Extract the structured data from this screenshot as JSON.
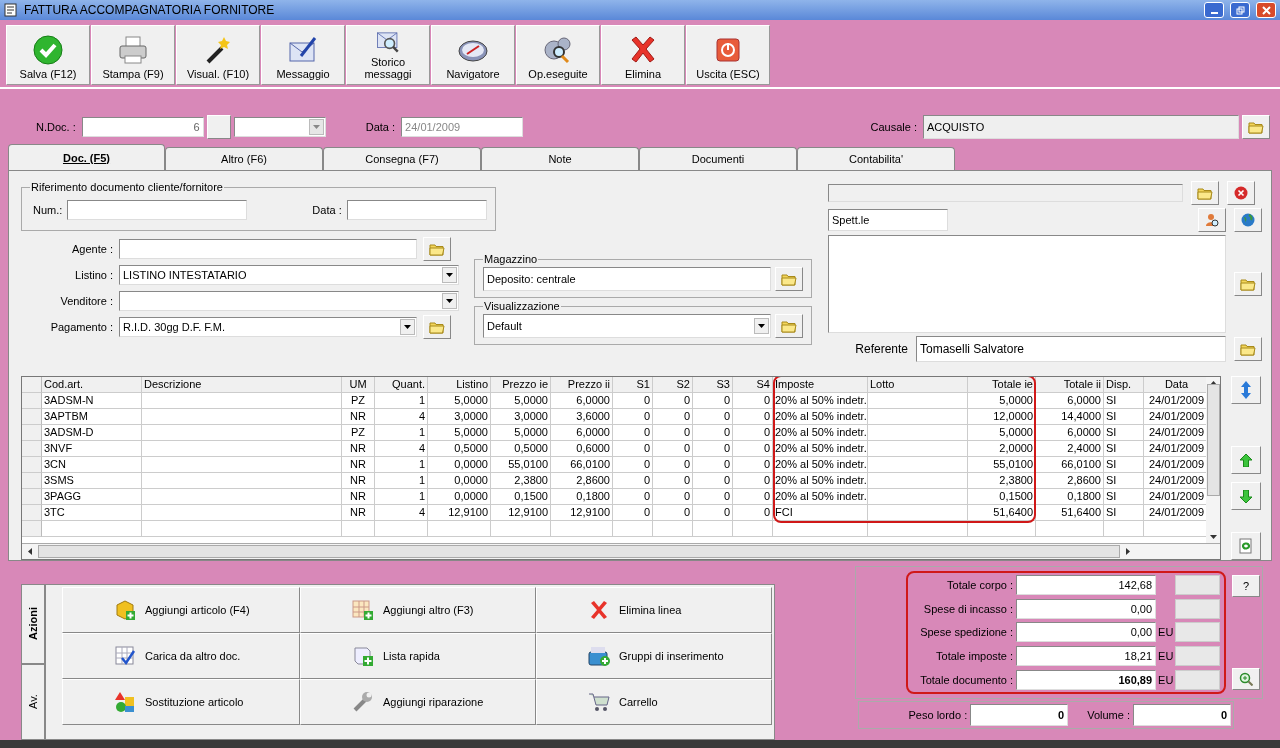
{
  "window": {
    "title": "FATTURA ACCOMPAGNATORIA FORNITORE"
  },
  "toolbar": [
    "Salva (F12)",
    "Stampa (F9)",
    "Visual. (F10)",
    "Messaggio",
    "Storico messaggi",
    "Navigatore",
    "Op.eseguite",
    "Elimina",
    "Uscita (ESC)"
  ],
  "header": {
    "ndoc_label": "N.Doc. :",
    "ndoc": "6",
    "data_label": "Data :",
    "data": "24/01/2009",
    "causale_label": "Causale :",
    "causale": "ACQUISTO"
  },
  "tabs": [
    {
      "label": "Doc. (F5)",
      "selected": true
    },
    {
      "label": "Altro (F6)",
      "selected": false
    },
    {
      "label": "Consegna (F7)",
      "selected": false
    },
    {
      "label": "Note",
      "selected": false
    },
    {
      "label": "Documenti",
      "selected": false
    },
    {
      "label": "Contabilita'",
      "selected": false
    }
  ],
  "riferimento": {
    "legend": "Riferimento documento cliente/fornitore",
    "num_label": "Num.:",
    "data_label": "Data :"
  },
  "fields": [
    {
      "label": "Agente :",
      "kind": "text",
      "folder": true
    },
    {
      "label": "Listino :",
      "value": "LISTINO INTESTATARIO",
      "kind": "combo",
      "folder": false
    },
    {
      "label": "Venditore :",
      "kind": "combo",
      "folder": false
    },
    {
      "label": "Pagamento :",
      "value": "R.I.D. 30gg D.F. F.M.",
      "kind": "combo",
      "folder": true
    }
  ],
  "magazzino": {
    "legend": "Magazzino",
    "value": "Deposito: centrale"
  },
  "visualizzazione": {
    "legend": "Visualizzazione",
    "value": "Default"
  },
  "intestatario": {
    "title": "Spett.le",
    "referente_label": "Referente",
    "referente": "Tomaselli Salvatore"
  },
  "table": {
    "columns": [
      "Cod.art.",
      "Descrizione",
      "UM",
      "Quant.",
      "Listino",
      "Prezzo ie",
      "Prezzo ii",
      "S1",
      "S2",
      "S3",
      "S4",
      "Imposte",
      "Lotto",
      "Totale ie",
      "Totale ii",
      "Disp.",
      "Data"
    ],
    "rows": [
      {
        "cod": "3ADSM-N",
        "um": "PZ",
        "quant": "1",
        "listino": "5,0000",
        "prezzo_ie": "5,0000",
        "prezzo_ii": "6,0000",
        "s1": "0",
        "s2": "0",
        "s3": "0",
        "s4": "0",
        "imposte": "20% al 50% indetr.",
        "totale_ie": "5,0000",
        "totale_ii": "6,0000",
        "disp": "SI",
        "data": "24/01/2009"
      },
      {
        "cod": "3APTBM",
        "um": "NR",
        "quant": "4",
        "listino": "3,0000",
        "prezzo_ie": "3,0000",
        "prezzo_ii": "3,6000",
        "s1": "0",
        "s2": "0",
        "s3": "0",
        "s4": "0",
        "imposte": "20% al 50% indetr.",
        "totale_ie": "12,0000",
        "totale_ii": "14,4000",
        "disp": "SI",
        "data": "24/01/2009"
      },
      {
        "cod": "3ADSM-D",
        "um": "PZ",
        "quant": "1",
        "listino": "5,0000",
        "prezzo_ie": "5,0000",
        "prezzo_ii": "6,0000",
        "s1": "0",
        "s2": "0",
        "s3": "0",
        "s4": "0",
        "imposte": "20% al 50% indetr.",
        "totale_ie": "5,0000",
        "totale_ii": "6,0000",
        "disp": "SI",
        "data": "24/01/2009"
      },
      {
        "cod": "3NVF",
        "um": "NR",
        "quant": "4",
        "listino": "0,5000",
        "prezzo_ie": "0,5000",
        "prezzo_ii": "0,6000",
        "s1": "0",
        "s2": "0",
        "s3": "0",
        "s4": "0",
        "imposte": "20% al 50% indetr.",
        "totale_ie": "2,0000",
        "totale_ii": "2,4000",
        "disp": "SI",
        "data": "24/01/2009"
      },
      {
        "cod": "3CN",
        "um": "NR",
        "quant": "1",
        "listino": "0,0000",
        "prezzo_ie": "55,0100",
        "prezzo_ii": "66,0100",
        "s1": "0",
        "s2": "0",
        "s3": "0",
        "s4": "0",
        "imposte": "20% al 50% indetr.",
        "totale_ie": "55,0100",
        "totale_ii": "66,0100",
        "disp": "SI",
        "data": "24/01/2009"
      },
      {
        "cod": "3SMS",
        "um": "NR",
        "quant": "1",
        "listino": "0,0000",
        "prezzo_ie": "2,3800",
        "prezzo_ii": "2,8600",
        "s1": "0",
        "s2": "0",
        "s3": "0",
        "s4": "0",
        "imposte": "20% al 50% indetr.",
        "totale_ie": "2,3800",
        "totale_ii": "2,8600",
        "disp": "SI",
        "data": "24/01/2009"
      },
      {
        "cod": "3PAGG",
        "um": "NR",
        "quant": "1",
        "listino": "0,0000",
        "prezzo_ie": "0,1500",
        "prezzo_ii": "0,1800",
        "s1": "0",
        "s2": "0",
        "s3": "0",
        "s4": "0",
        "imposte": "20% al 50% indetr.",
        "totale_ie": "0,1500",
        "totale_ii": "0,1800",
        "disp": "SI",
        "data": "24/01/2009"
      },
      {
        "cod": "3TC",
        "um": "NR",
        "quant": "4",
        "listino": "12,9100",
        "prezzo_ie": "12,9100",
        "prezzo_ii": "12,9100",
        "s1": "0",
        "s2": "0",
        "s3": "0",
        "s4": "0",
        "imposte": "FCI",
        "totale_ie": "51,6400",
        "totale_ii": "51,6400",
        "disp": "SI",
        "data": "24/01/2009"
      }
    ]
  },
  "side_tabs": [
    {
      "label": "Azioni",
      "selected": true
    },
    {
      "label": "Av.",
      "selected": false
    }
  ],
  "actions": [
    "Aggiungi articolo (F4)",
    "Aggiungi altro (F3)",
    "Elimina linea",
    "Carica da altro doc.",
    "Lista rapida",
    "Gruppi di inserimento",
    "Sostituzione articolo",
    "Aggiungi riparazione",
    "Carrello"
  ],
  "totals": [
    {
      "label": "Totale corpo :",
      "value": "142,68",
      "emphasis": false
    },
    {
      "label": "Spese di incasso :",
      "value": "0,00",
      "emphasis": false
    },
    {
      "label": "Spese spedizione :",
      "value": "0,00",
      "unit": "EU",
      "emphasis": false
    },
    {
      "label": "Totale imposte :",
      "value": "18,21",
      "unit": "EU",
      "emphasis": false
    },
    {
      "label": "Totale documento :",
      "value": "160,89",
      "unit": "EU",
      "emphasis": true
    }
  ],
  "help_button": "?",
  "peso": {
    "label": "Peso lordo :",
    "value": "0"
  },
  "volume": {
    "label": "Volume :",
    "value": "0"
  }
}
